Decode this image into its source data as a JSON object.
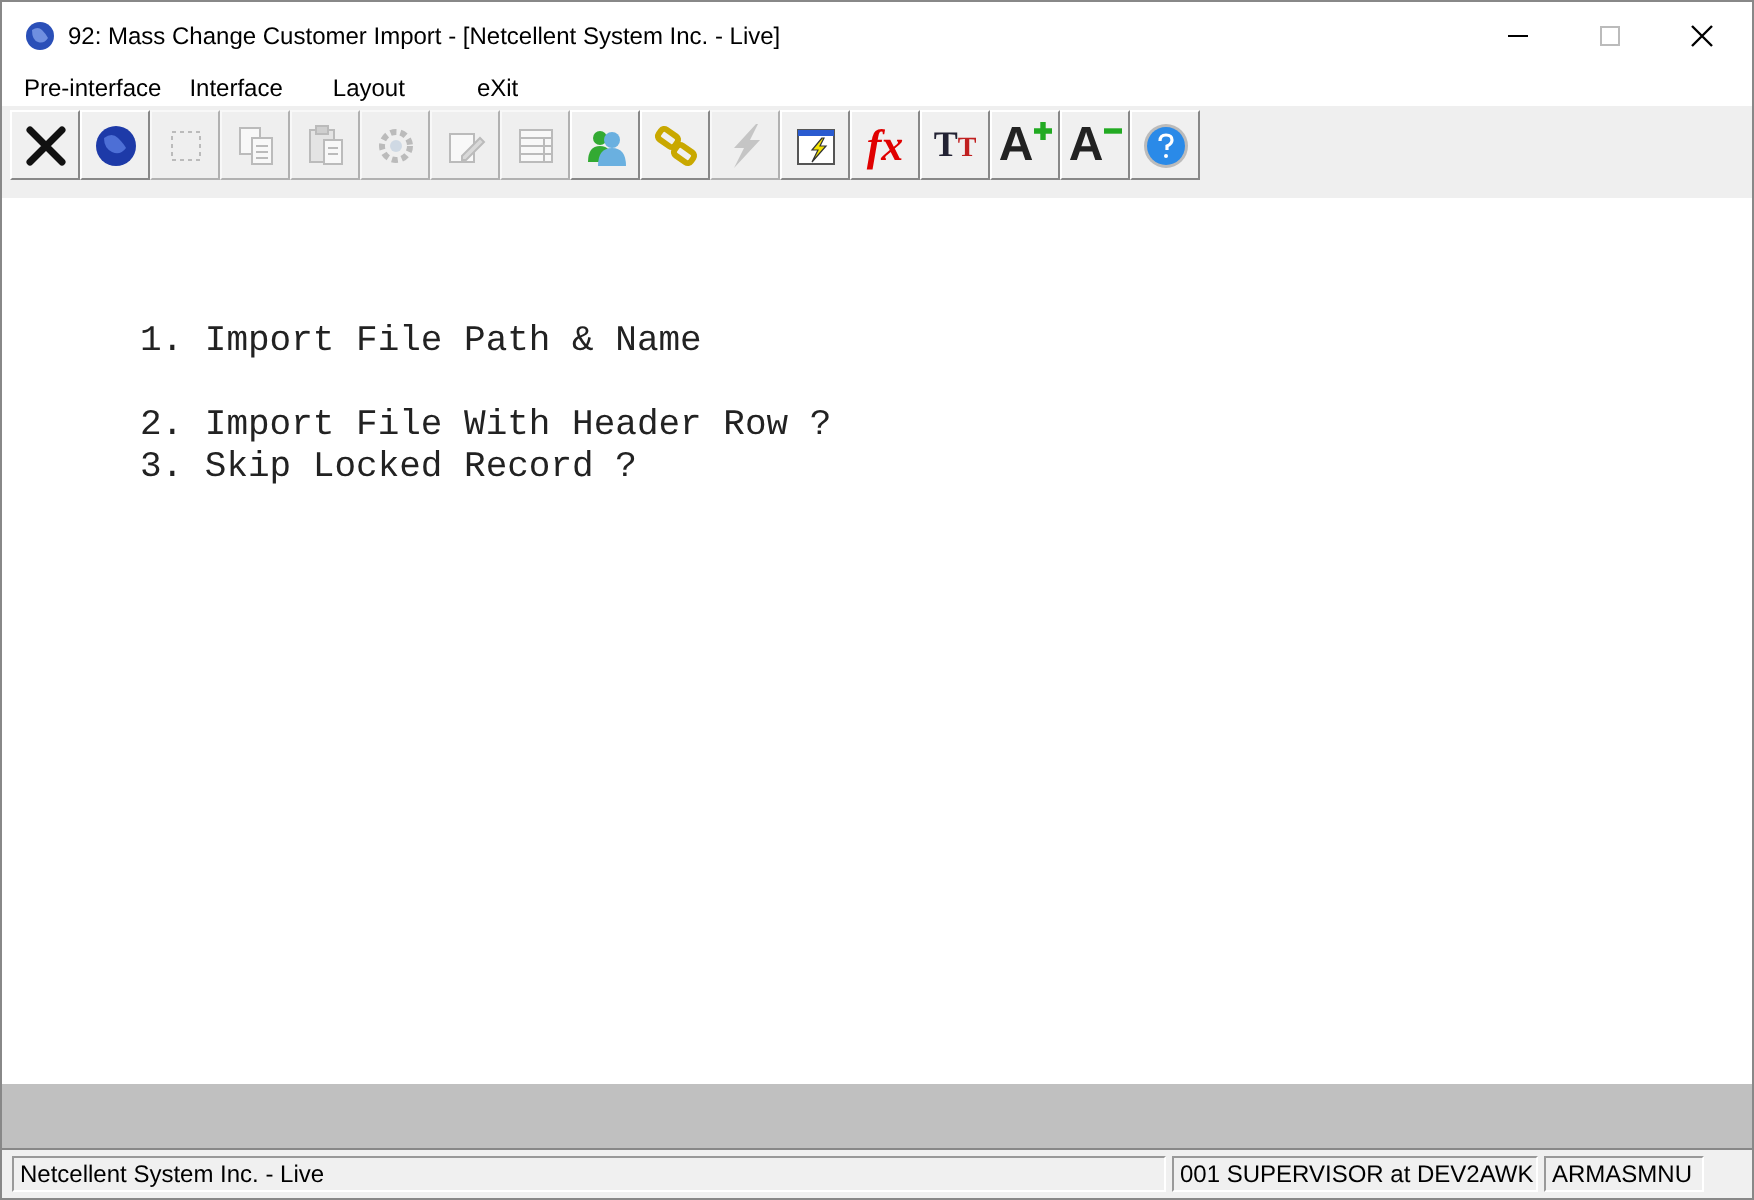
{
  "window": {
    "title": "92: Mass Change Customer Import - [Netcellent System Inc. - Live]"
  },
  "menu": [
    "Pre-interface",
    "Interface",
    "Layout",
    "eXit"
  ],
  "toolbar": [
    {
      "kind": "close",
      "disabled": false
    },
    {
      "kind": "globe",
      "disabled": false
    },
    {
      "kind": "select",
      "disabled": true
    },
    {
      "kind": "copy",
      "disabled": true
    },
    {
      "kind": "paste",
      "disabled": true
    },
    {
      "kind": "gear",
      "disabled": true
    },
    {
      "kind": "edit",
      "disabled": true
    },
    {
      "kind": "table",
      "disabled": true
    },
    {
      "kind": "users",
      "disabled": false
    },
    {
      "kind": "link",
      "disabled": false
    },
    {
      "kind": "bolt",
      "disabled": true
    },
    {
      "kind": "window-bolt",
      "disabled": false
    },
    {
      "kind": "fx",
      "label": "fx",
      "disabled": false
    },
    {
      "kind": "font-size",
      "label": "TT",
      "disabled": false
    },
    {
      "kind": "font-up",
      "label": "A",
      "disabled": false
    },
    {
      "kind": "font-down",
      "label": "A",
      "disabled": false
    },
    {
      "kind": "help",
      "disabled": false
    }
  ],
  "prompts": [
    {
      "text": "1. Import File Path & Name"
    },
    {
      "text": "2. Import File With Header Row ?"
    },
    {
      "text": "3. Skip Locked Record ?"
    }
  ],
  "status_bar": [
    "Netcellent System Inc. - Live",
    "001 SUPERVISOR at DEV2AWK",
    "ARMASMNU"
  ]
}
